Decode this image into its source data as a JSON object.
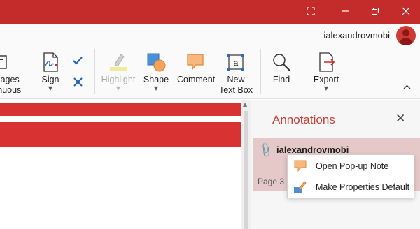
{
  "window": {
    "controls": [
      "restore-fullscreen",
      "minimize",
      "maximize",
      "close"
    ],
    "title_bar_color": "#c42b2b"
  },
  "account": {
    "username": "ialexandrovmobi"
  },
  "ribbon": {
    "partial_button": {
      "label_line1": "Pages",
      "label_line2": "tinuous"
    },
    "sign": {
      "label": "Sign"
    },
    "highlight": {
      "label": "Highlight",
      "disabled": true
    },
    "shape": {
      "label": "Shape"
    },
    "comment": {
      "label": "Comment"
    },
    "new_text_box": {
      "label_line1": "New",
      "label_line2": "Text Box"
    },
    "find": {
      "label": "Find"
    },
    "export": {
      "label": "Export"
    },
    "collapse": "collapse-ribbon"
  },
  "annotations_pane": {
    "title": "Annotations",
    "item": {
      "author": "ialexandrovmobi",
      "page": "Page 3"
    }
  },
  "context_menu": {
    "items": [
      {
        "label": "Open Pop-up Note",
        "icon": "comment-note-icon"
      },
      {
        "label": "Make Properties Default",
        "icon": "properties-default-icon"
      }
    ]
  },
  "colors": {
    "accent": "#c42b2b",
    "pane_title": "#c2413a",
    "selected_item": "#e5c8c8",
    "comment_icon": "#f5a35a",
    "shape_blue": "#4a90d9"
  }
}
